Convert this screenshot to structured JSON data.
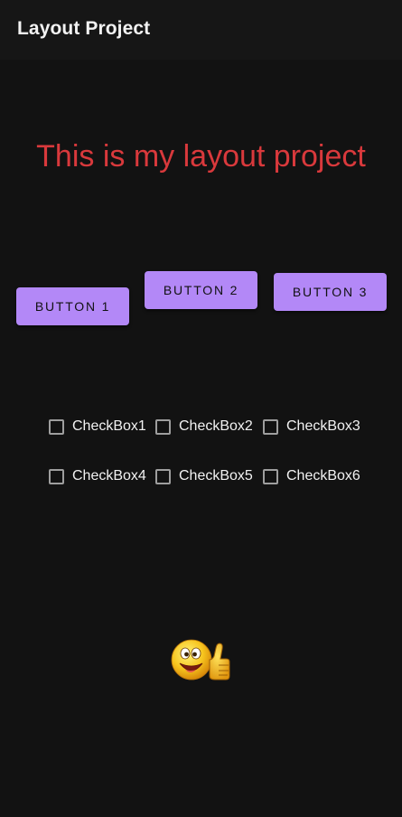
{
  "app_bar": {
    "title": "Layout Project"
  },
  "main": {
    "headline": "This is my layout project",
    "headline_color": "#d9393c",
    "buttons": [
      {
        "label": "BUTTON 1"
      },
      {
        "label": "BUTTON 2"
      },
      {
        "label": "BUTTON 3"
      }
    ],
    "button_color": "#b388f7",
    "checkboxes": [
      {
        "label": "CheckBox1",
        "checked": false
      },
      {
        "label": "CheckBox2",
        "checked": false
      },
      {
        "label": "CheckBox3",
        "checked": false
      },
      {
        "label": "CheckBox4",
        "checked": false
      },
      {
        "label": "CheckBox5",
        "checked": false
      },
      {
        "label": "CheckBox6",
        "checked": false
      }
    ],
    "image": {
      "icon": "thumbs-up-emoji-icon"
    }
  },
  "colors": {
    "background": "#121212"
  }
}
